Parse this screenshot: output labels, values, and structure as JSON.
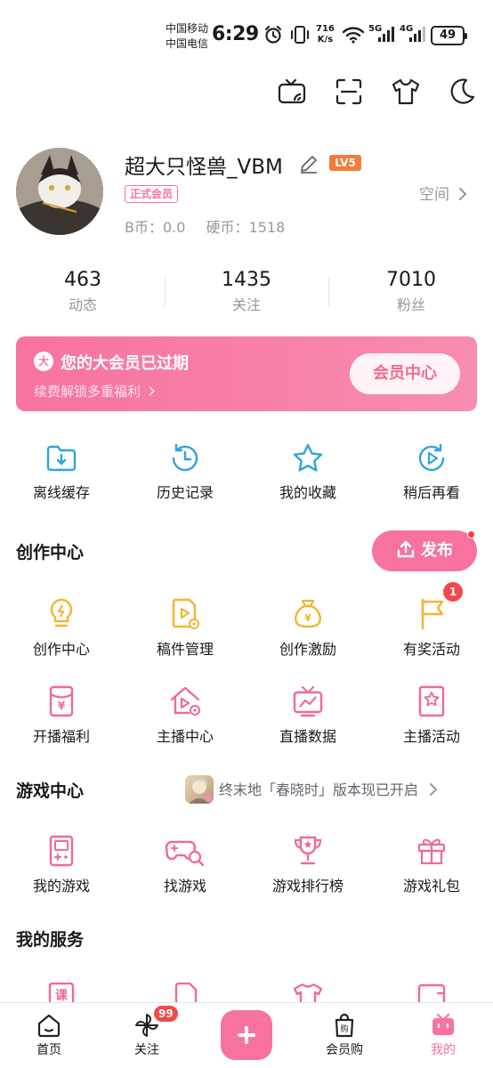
{
  "status_bar": {
    "carrier_1": "中国移动",
    "carrier_2": "中国电信",
    "time": "6:29",
    "speed_value": "716",
    "speed_unit": "K/s",
    "net_1": "5G",
    "net_2": "4G",
    "battery": "49"
  },
  "profile": {
    "username": "超大只怪兽_VBM",
    "level": "LV5",
    "member_badge": "正式会员",
    "b_coins": "B币：0.0",
    "hard_coins": "硬币：1518",
    "space_link": "空间"
  },
  "stats": [
    {
      "value": "463",
      "label": "动态"
    },
    {
      "value": "1435",
      "label": "关注"
    },
    {
      "value": "7010",
      "label": "粉丝"
    }
  ],
  "vip_banner": {
    "badge": "大",
    "title": "您的大会员已过期",
    "subtitle": "续费解锁多重福利",
    "button": "会员中心"
  },
  "quick_actions": [
    {
      "label": "离线缓存",
      "icon": "download-folder-icon"
    },
    {
      "label": "历史记录",
      "icon": "history-clock-icon"
    },
    {
      "label": "我的收藏",
      "icon": "star-icon"
    },
    {
      "label": "稍后再看",
      "icon": "watch-later-icon"
    }
  ],
  "creator_center": {
    "title": "创作中心",
    "publish_button": "发布",
    "items": [
      {
        "label": "创作中心",
        "icon": "lightbulb-icon"
      },
      {
        "label": "稿件管理",
        "icon": "manuscript-icon"
      },
      {
        "label": "创作激励",
        "icon": "money-bag-icon"
      },
      {
        "label": "有奖活动",
        "icon": "flag-icon",
        "badge": "1"
      },
      {
        "label": "开播福利",
        "icon": "red-envelope-icon"
      },
      {
        "label": "主播中心",
        "icon": "streamer-home-icon"
      },
      {
        "label": "直播数据",
        "icon": "live-data-icon"
      },
      {
        "label": "主播活动",
        "icon": "bookmark-star-icon"
      }
    ]
  },
  "game_center": {
    "title": "游戏中心",
    "promo": "终末地「春晓时」版本现已开启",
    "items": [
      {
        "label": "我的游戏",
        "icon": "gameboy-icon"
      },
      {
        "label": "找游戏",
        "icon": "gamepad-search-icon"
      },
      {
        "label": "游戏排行榜",
        "icon": "trophy-icon"
      },
      {
        "label": "游戏礼包",
        "icon": "gift-icon"
      }
    ]
  },
  "my_services": {
    "title": "我的服务"
  },
  "bottom_nav": [
    {
      "label": "首页",
      "icon": "home-icon"
    },
    {
      "label": "关注",
      "icon": "pinwheel-icon",
      "badge": "99"
    },
    {
      "label": "",
      "icon": "plus-icon"
    },
    {
      "label": "会员购",
      "icon": "shopping-bag-icon"
    },
    {
      "label": "我的",
      "icon": "tv-mine-icon"
    }
  ],
  "colors": {
    "accent_pink": "#f7739e",
    "icon_blue": "#2fa4d8",
    "icon_yellow": "#f2b632",
    "icon_pink": "#f06a93",
    "text_gray": "#9499a0"
  }
}
